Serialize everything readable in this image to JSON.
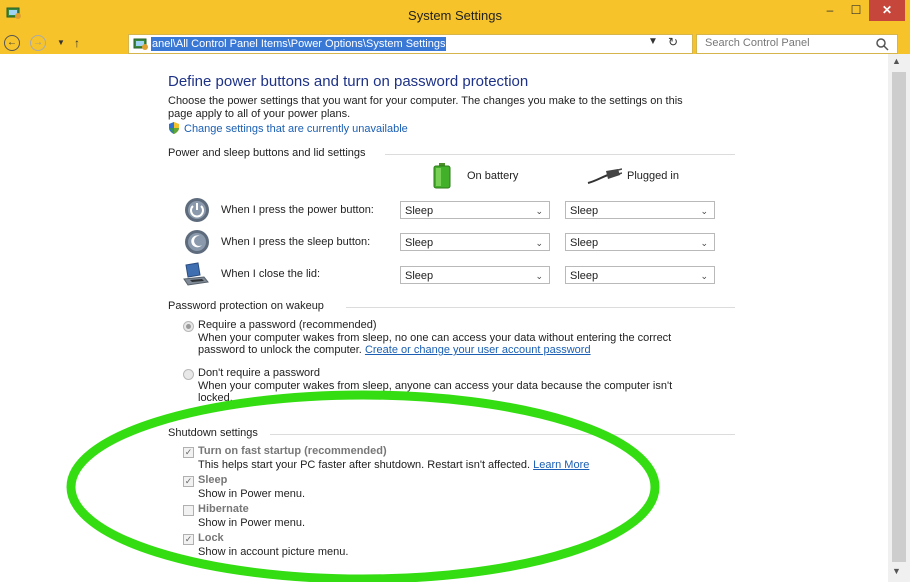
{
  "window": {
    "title": "System Settings",
    "minimize": "–",
    "maximize": "☐",
    "close": "✕"
  },
  "nav": {
    "back": "←",
    "forward": "→",
    "dropdown": "▼",
    "up": "↑",
    "address": "anel\\All Control Panel Items\\Power Options\\System Settings",
    "address_dropdown": "▼",
    "refresh": "↻",
    "search_placeholder": "Search Control Panel"
  },
  "page": {
    "heading": "Define power buttons and turn on password protection",
    "intro_line1": "Choose the power settings that you want for your computer. The changes you make to the settings on this",
    "intro_line2": "page apply to all of your power plans.",
    "change_link": "Change settings that are currently unavailable"
  },
  "power": {
    "section_title": "Power and sleep buttons and lid settings",
    "col_battery": "On battery",
    "col_plugged": "Plugged in",
    "rows": [
      {
        "label": "When I press the power button:",
        "battery": "Sleep",
        "plugged": "Sleep"
      },
      {
        "label": "When I press the sleep button:",
        "battery": "Sleep",
        "plugged": "Sleep"
      },
      {
        "label": "When I close the lid:",
        "battery": "Sleep",
        "plugged": "Sleep"
      }
    ],
    "chevron": "⌄"
  },
  "password": {
    "section_title": "Password protection on wakeup",
    "require_label": "Require a password (recommended)",
    "require_desc1": "When your computer wakes from sleep, no one can access your data without entering the correct",
    "require_desc2_prefix": "password to unlock the computer.",
    "require_link": "Create or change your user account password",
    "norequire_label": "Don't require a password",
    "norequire_desc1": "When your computer wakes from sleep, anyone can access your data because the computer isn't",
    "norequire_desc2": "locked."
  },
  "shutdown": {
    "section_title": "Shutdown settings",
    "items": [
      {
        "label": "Turn on fast startup (recommended)",
        "desc": "This helps start your PC faster after shutdown. Restart isn't affected.",
        "link": "Learn More",
        "checked": true
      },
      {
        "label": "Sleep",
        "desc": "Show in Power menu.",
        "checked": true
      },
      {
        "label": "Hibernate",
        "desc": "Show in Power menu.",
        "checked": false
      },
      {
        "label": "Lock",
        "desc": "Show in account picture menu.",
        "checked": true
      }
    ],
    "check_mark": "✓"
  },
  "scroll": {
    "up": "▲",
    "down": "▼"
  },
  "colors": {
    "titlebar": "#f6c32a",
    "heading": "#1e3287",
    "link": "#1a5fb4",
    "highlight_ring": "#33dd11",
    "close": "#c7463c"
  }
}
